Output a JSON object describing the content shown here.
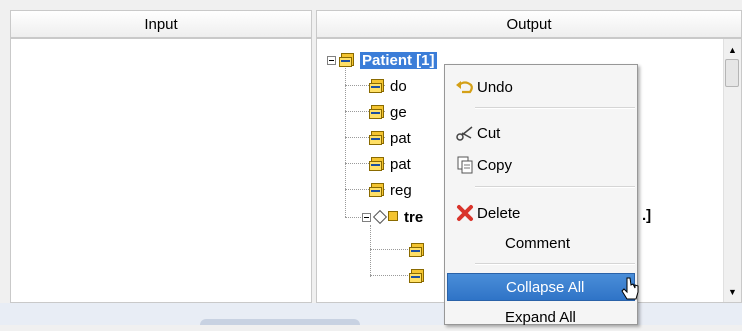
{
  "panels": {
    "input": {
      "label": "Input"
    },
    "output": {
      "label": "Output"
    }
  },
  "tree": {
    "root": {
      "label": "Patient [1]",
      "expanded": true,
      "selected": true
    },
    "children": [
      {
        "label": "do"
      },
      {
        "label": "ge"
      },
      {
        "label": "pat"
      },
      {
        "label": "pat"
      },
      {
        "label": "reg"
      },
      {
        "label": "tre",
        "bold": true,
        "suffix": ".]",
        "expanded": true
      },
      {
        "label": ""
      },
      {
        "label": ""
      }
    ]
  },
  "context_menu": {
    "items": [
      {
        "label": "Undo",
        "icon": "undo-icon"
      },
      {
        "label": "Cut",
        "icon": "scissors-icon"
      },
      {
        "label": "Copy",
        "icon": "copy-icon"
      },
      {
        "label": "Delete",
        "icon": "delete-icon"
      },
      {
        "label": "Comment"
      },
      {
        "label": "Collapse All",
        "highlighted": true
      },
      {
        "label": "Expand All"
      }
    ]
  },
  "colors": {
    "selection": "#3b7dd8",
    "menu_highlight": "#2f74c7",
    "delete_icon": "#d9342b"
  }
}
